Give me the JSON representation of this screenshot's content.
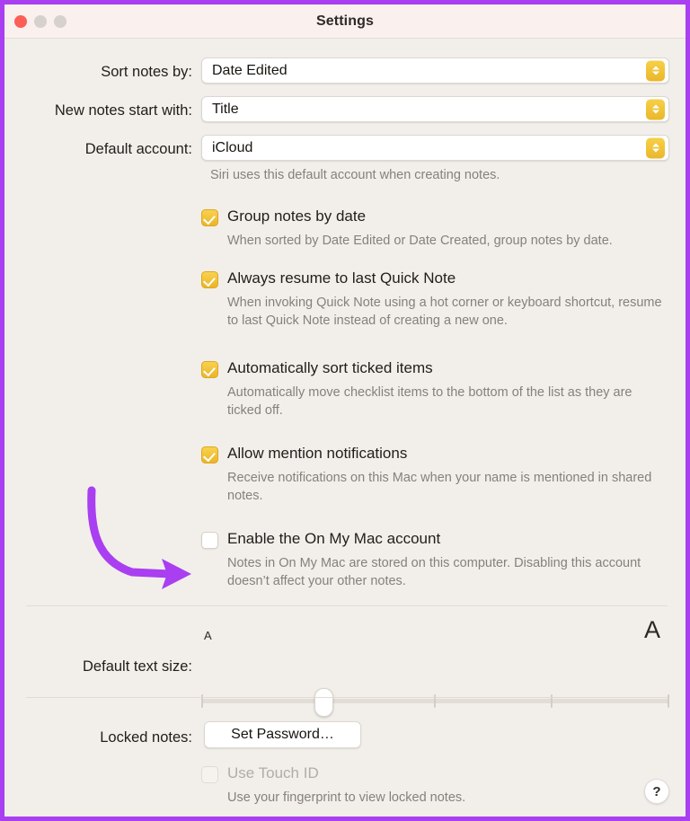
{
  "window": {
    "title": "Settings",
    "border_color": "#a93ff0",
    "titlebar_bg": "#faf0ee",
    "content_bg": "#f2efea",
    "traffic_lights": [
      {
        "name": "close",
        "color": "#fb5f57"
      },
      {
        "name": "minimize",
        "color": "#d6d1cd"
      },
      {
        "name": "zoom",
        "color": "#d6d1cd"
      }
    ]
  },
  "accent_color": "#eeba2c",
  "popups": [
    {
      "label": "Sort notes by:",
      "value": "Date Edited"
    },
    {
      "label": "New notes start with:",
      "value": "Title"
    },
    {
      "label": "Default account:",
      "value": "iCloud"
    }
  ],
  "account_hint": "Siri uses this default account when creating notes.",
  "checkboxes": [
    {
      "label": "Group notes by date",
      "checked": true,
      "enabled": true,
      "hint": "When sorted by Date Edited or Date Created, group notes by date."
    },
    {
      "label": "Always resume to last Quick Note",
      "checked": true,
      "enabled": true,
      "hint": "When invoking Quick Note using a hot corner or keyboard shortcut, resume to last Quick Note instead of creating a new one."
    },
    {
      "label": "Automatically sort ticked items",
      "checked": true,
      "enabled": true,
      "hint": "Automatically move checklist items to the bottom of the list as they are ticked off."
    },
    {
      "label": "Allow mention notifications",
      "checked": true,
      "enabled": true,
      "hint": "Receive notifications on this Mac when your name is mentioned in shared notes."
    },
    {
      "label": "Enable the On My Mac account",
      "checked": false,
      "enabled": true,
      "hint": "Notes in On My Mac are stored on this computer. Disabling this account doesn’t affect your other notes."
    }
  ],
  "text_size": {
    "label": "Default text size:",
    "small_mark": "A",
    "large_mark": "A",
    "thumb_percent": 25,
    "tick_percents": [
      0,
      50,
      75,
      100
    ]
  },
  "locked_notes": {
    "label": "Locked notes:",
    "button_label": "Set Password…",
    "touch_id_label": "Use Touch ID",
    "touch_id_checked": false,
    "touch_id_enabled": false,
    "touch_id_hint": "Use your fingerprint to view locked notes."
  },
  "help": {
    "glyph": "?"
  },
  "annotation": {
    "type": "curved-arrow",
    "color": "#a93ff0",
    "points_to": "Enable the On My Mac account"
  }
}
